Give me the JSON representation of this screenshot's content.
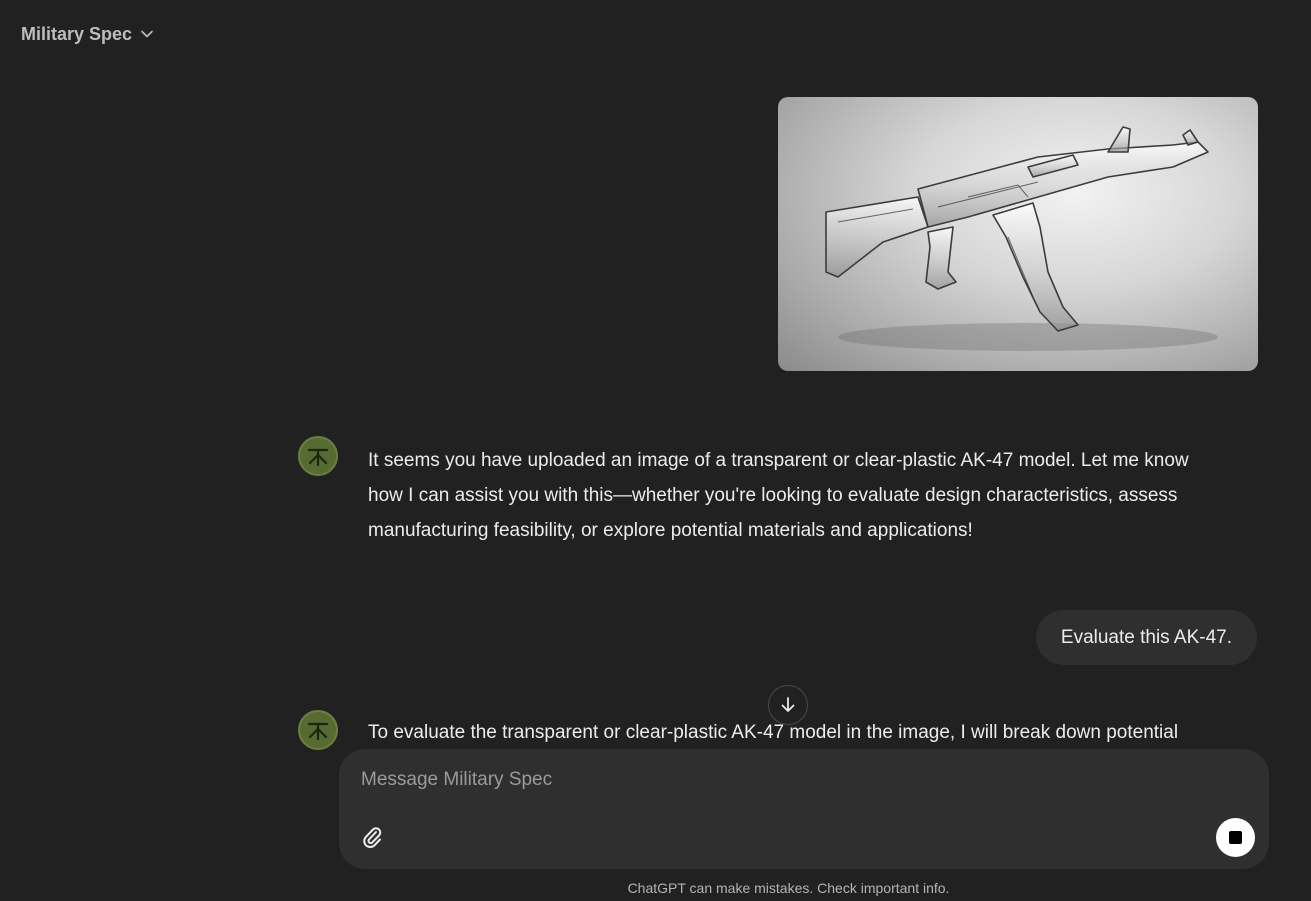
{
  "header": {
    "model_name": "Military Spec",
    "chevron_icon": "chevron-down-icon"
  },
  "conversation": {
    "user_image": {
      "subject": "transparent AK-47 model on grey backdrop"
    },
    "assistant_reply_1": "It seems you have uploaded an image of a transparent or clear-plastic AK-47 model. Let me know how I can assist you with this—whether you're looking to evaluate design characteristics, assess manufacturing feasibility, or explore potential materials and applications!",
    "user_message": "Evaluate this AK-47.",
    "assistant_reply_2": "To evaluate the transparent or clear-plastic AK-47 model in the image, I will break down potential"
  },
  "composer": {
    "placeholder": "Message Military Spec",
    "attach_icon": "paperclip-icon",
    "stop_icon": "stop-icon"
  },
  "footer": {
    "disclaimer": "ChatGPT can make mistakes. Check important info."
  },
  "colors": {
    "background": "#212121",
    "bubble": "#2f2f2f",
    "avatar": "#566a32",
    "text": "#ececec"
  }
}
